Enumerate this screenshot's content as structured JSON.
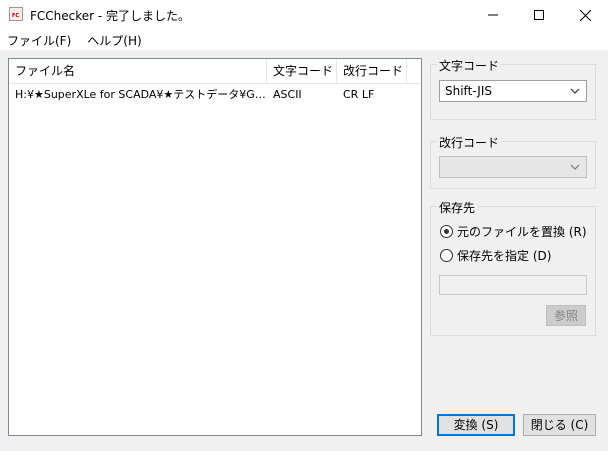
{
  "window": {
    "title": "FCChecker - 完了しました。",
    "icon_text": "FC"
  },
  "menu": {
    "items": [
      "ファイル(F)",
      "ヘルプ(H)"
    ]
  },
  "list": {
    "columns": [
      "ファイル名",
      "文字コード",
      "改行コード"
    ],
    "rows": [
      {
        "file": "H:¥★SuperXLe for SCADA¥★テストデータ¥Galaxy…",
        "encoding": "ASCII",
        "newline": "CR LF"
      }
    ]
  },
  "encoding_group": {
    "label": "文字コード",
    "selected": "Shift-JIS"
  },
  "newline_group": {
    "label": "改行コード",
    "selected": ""
  },
  "save_group": {
    "label": "保存先",
    "option_replace": "元のファイルを置換 (R)",
    "option_specify": "保存先を指定 (D)",
    "path_value": "",
    "browse_label": "参照"
  },
  "buttons": {
    "convert": "変換 (S)",
    "close": "閉じる (C)"
  }
}
